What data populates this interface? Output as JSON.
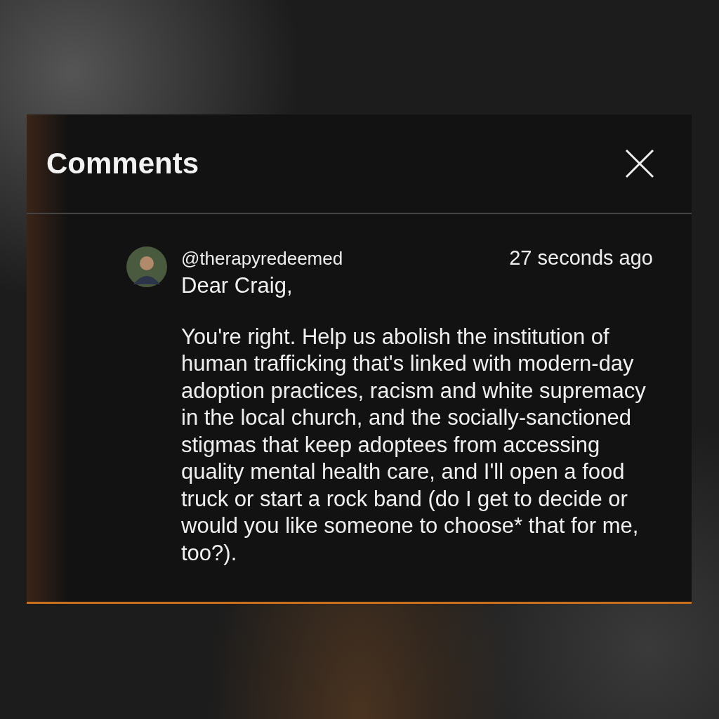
{
  "panel": {
    "title": "Comments"
  },
  "comment": {
    "username": "@therapyredeemed",
    "time": "27 seconds ago",
    "paragraphs": [
      "Dear Craig,",
      "You're right. Help us abolish the institution of human trafficking that's linked with modern-day adoption practices, racism and white supremacy in the local church, and the socially-sanctioned stigmas that keep adoptees from accessing quality mental health care, and I'll open a food truck or start a rock band (do I get to decide or would you like someone to choose* that for me, too?)."
    ]
  }
}
